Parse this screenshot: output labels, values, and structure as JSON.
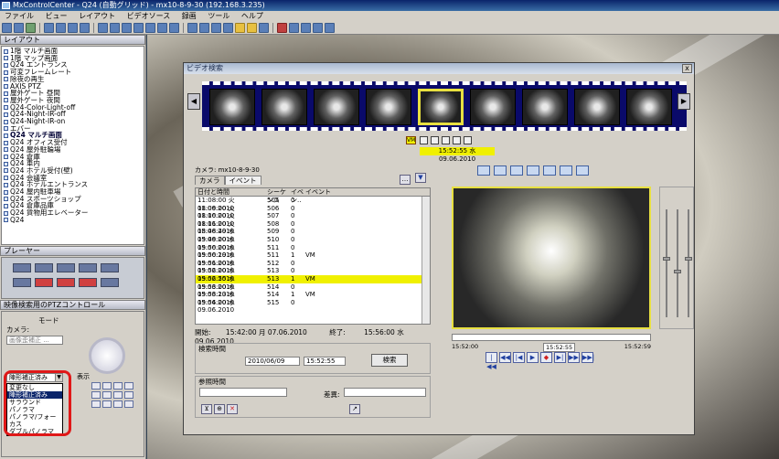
{
  "window": {
    "title": "MxControlCenter - Q24 (自動グリッド) - mx10-8-9-30 (192.168.3.235)"
  },
  "menu": [
    "ファイル",
    "ビュー",
    "レイアウト",
    "ビデオソース",
    "録画",
    "ツール",
    "ヘルプ"
  ],
  "left": {
    "layout_header": "レイアウト",
    "tree": [
      {
        "text": "1階 マルチ画面",
        "bold": false
      },
      {
        "text": "1階 マップ画面",
        "bold": false
      },
      {
        "text": "Q24 エントランス",
        "bold": false
      },
      {
        "text": "可変フレームレート",
        "bold": false
      },
      {
        "text": "除夜の再生",
        "bold": false
      },
      {
        "text": "AXIS PTZ",
        "bold": false
      },
      {
        "text": "屋外ゲート 昼間",
        "bold": false
      },
      {
        "text": "屋外ゲート 夜間",
        "bold": false
      },
      {
        "text": "Q24-Color-Light-off",
        "bold": false
      },
      {
        "text": "Q24-Night-IR-off",
        "bold": false
      },
      {
        "text": "Q24-Night-IR-on",
        "bold": false
      },
      {
        "text": "エバー",
        "bold": false
      },
      {
        "text": "Q24 マルチ画面",
        "bold": true
      },
      {
        "text": "Q24 オフィス受付",
        "bold": false
      },
      {
        "text": "Q24 屋外駐輪場",
        "bold": false
      },
      {
        "text": "Q24 倉庫",
        "bold": false
      },
      {
        "text": "Q24 車内",
        "bold": false
      },
      {
        "text": "Q24 ホテル受付(壁)",
        "bold": false
      },
      {
        "text": "Q24 会議室",
        "bold": false
      },
      {
        "text": "Q24 ホテルエントランス",
        "bold": false
      },
      {
        "text": "Q24 屋内駐車場",
        "bold": false
      },
      {
        "text": "Q24 スポーツショップ",
        "bold": false
      },
      {
        "text": "Q24 倉庫品庫",
        "bold": false
      },
      {
        "text": "Q24 貨物用エレベーター",
        "bold": false
      },
      {
        "text": "Q24",
        "bold": false
      }
    ],
    "player_header": "プレーヤー",
    "ptz_header": "映像検索用のPTZコントロール",
    "mode_label": "モード",
    "camera_label": "カメラ:",
    "camera_value": "画像歪補正 ...",
    "dropdown_value": "陣形補正済み",
    "dropdown_options": [
      "変更なし",
      "陣形補正済み",
      "サラウンド",
      "パノラマ",
      "パノラマ/フォーカス",
      "ダブルパノラマ"
    ],
    "display_label": "表示"
  },
  "dialog": {
    "title": "ビデオ検索",
    "close_label": "x",
    "timestamp": "15:52:55 水 09.06.2010",
    "vm_label": "VM",
    "camera_line": "カメラ: mx10-8-9-30",
    "tabs": [
      "カメラ",
      "イベント"
    ],
    "columns": [
      "日付と時間",
      "シーケンス",
      "イベン..",
      "イベント"
    ],
    "rows": [
      [
        "11:08:00 火 08.06.2010",
        "505",
        "0",
        ""
      ],
      [
        "11:09:00 火 08.06.2010",
        "506",
        "0",
        ""
      ],
      [
        "11:10:00 火 08.06.2010",
        "507",
        "0",
        ""
      ],
      [
        "11:11:00 火 08.06.2010",
        "508",
        "0",
        ""
      ],
      [
        "15:48:49 水 09.06.2010",
        "509",
        "0",
        ""
      ],
      [
        "15:49:00 水 09.06.2010",
        "510",
        "0",
        ""
      ],
      [
        "15:50:00 水 09.06.2010",
        "511",
        "0",
        ""
      ],
      [
        "15:50:19 水 09.06.2010",
        "511",
        "1",
        "VM"
      ],
      [
        "15:51:00 水 09.06.2010",
        "512",
        "0",
        ""
      ],
      [
        "15:52:00 水 09.06.2010",
        "513",
        "0",
        ""
      ],
      [
        "15:52:55 水 09.06.2010",
        "513",
        "1",
        "VM"
      ],
      [
        "15:53:00 水 09.06.2010",
        "514",
        "0",
        ""
      ],
      [
        "15:53:13 水 09.06.2010",
        "514",
        "1",
        "VM"
      ],
      [
        "15:54:00 水 09.06.2010",
        "515",
        "0",
        ""
      ]
    ],
    "highlight_row": 10,
    "start_label": "開始:",
    "start_value": "15:42:00 月 07.06.2010",
    "end_label": "終了:",
    "end_value": "15:56:00 水 09.06.2010",
    "search_time_label": "検索時間",
    "date_value": "2010/06/09",
    "time_value": "15:52:55",
    "search_button": "検索",
    "ref_time_label": "参照時間",
    "diff_label": "差異:",
    "timeline_left": "15:52:00",
    "timeline_mid": "15:52:55",
    "timeline_right": "15:52:59",
    "transport": [
      "|◀◀",
      "◀◀",
      "|◀",
      "▶",
      "◆",
      "▶|",
      "▶▶",
      "▶▶|"
    ]
  }
}
